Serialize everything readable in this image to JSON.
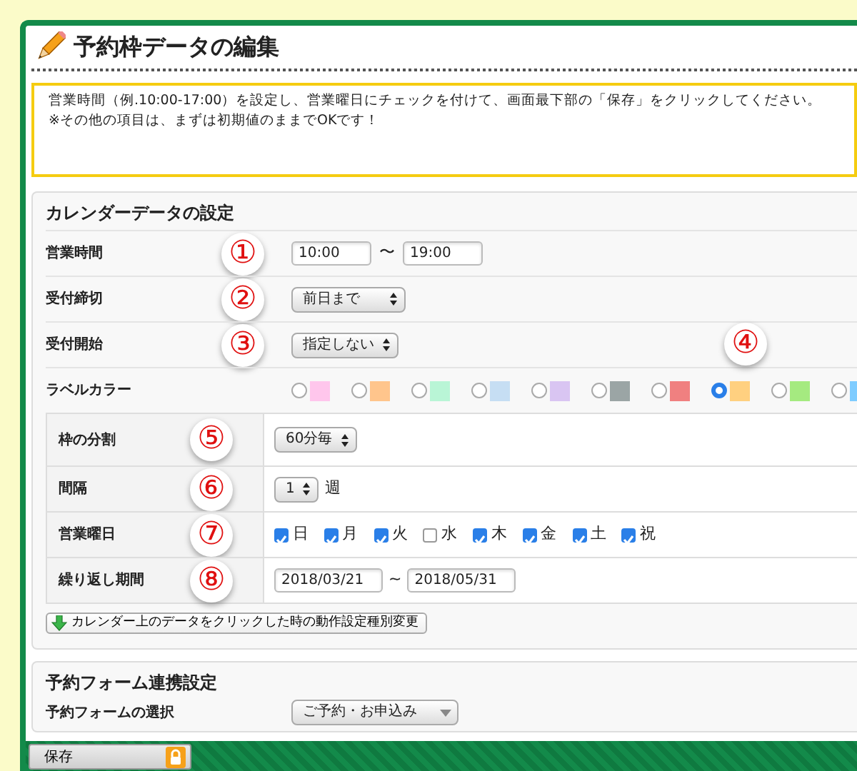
{
  "page_title": "予約枠データの編集",
  "notice": [
    "営業時間（例.10:00-17:00）を設定し、営業曜日にチェックを付けて、画面最下部の「保存」をクリックしてください。",
    "※その他の項目は、まずは初期値のままでOKです！"
  ],
  "calendar_section": {
    "title": "カレンダーデータの設定",
    "rows": [
      {
        "kind": "time_range",
        "label": "営業時間",
        "marker": "①",
        "from": "10:00",
        "separator": "〜",
        "to": "19:00"
      },
      {
        "kind": "select",
        "label": "受付締切",
        "marker": "②",
        "value": "前日まで"
      },
      {
        "kind": "select",
        "label": "受付開始",
        "marker": "③",
        "value": "指定しない"
      },
      {
        "kind": "colors",
        "label": "ラベルカラー",
        "marker": "④",
        "colors": [
          {
            "color": "#ffc6ec",
            "selected": false
          },
          {
            "color": "#ffc58c",
            "selected": false
          },
          {
            "color": "#b9f5d6",
            "selected": false
          },
          {
            "color": "#c6def3",
            "selected": false
          },
          {
            "color": "#d9c5f2",
            "selected": false
          },
          {
            "color": "#9ba5a5",
            "selected": false
          },
          {
            "color": "#f08080",
            "selected": false
          },
          {
            "color": "#ffd080",
            "selected": true
          },
          {
            "color": "#a5ea80",
            "selected": false
          },
          {
            "color": "#7fccff",
            "selected": false
          }
        ]
      }
    ],
    "table_rows": [
      {
        "kind": "select",
        "label": "枠の分割",
        "marker": "⑤",
        "value": "60分毎"
      },
      {
        "kind": "select_unit",
        "label": "間隔",
        "marker": "⑥",
        "value": "1",
        "unit": "週"
      },
      {
        "kind": "days",
        "label": "営業曜日",
        "marker": "⑦",
        "days": [
          {
            "label": "日",
            "checked": true
          },
          {
            "label": "月",
            "checked": true
          },
          {
            "label": "火",
            "checked": true
          },
          {
            "label": "水",
            "checked": false
          },
          {
            "label": "木",
            "checked": true
          },
          {
            "label": "金",
            "checked": true
          },
          {
            "label": "土",
            "checked": true
          },
          {
            "label": "祝",
            "checked": true
          }
        ]
      },
      {
        "kind": "date_range",
        "label": "繰り返し期間",
        "marker": "⑧",
        "from": "2018/03/21",
        "separator": "~",
        "to": "2018/05/31"
      }
    ],
    "toggle_button": "カレンダー上のデータをクリックした時の動作設定種別変更"
  },
  "form_section": {
    "title": "予約フォーム連携設定",
    "rows": [
      {
        "label": "予約フォームの選択",
        "value": "ご予約・お申込み"
      }
    ]
  },
  "footer": {
    "save_button": "保存"
  }
}
